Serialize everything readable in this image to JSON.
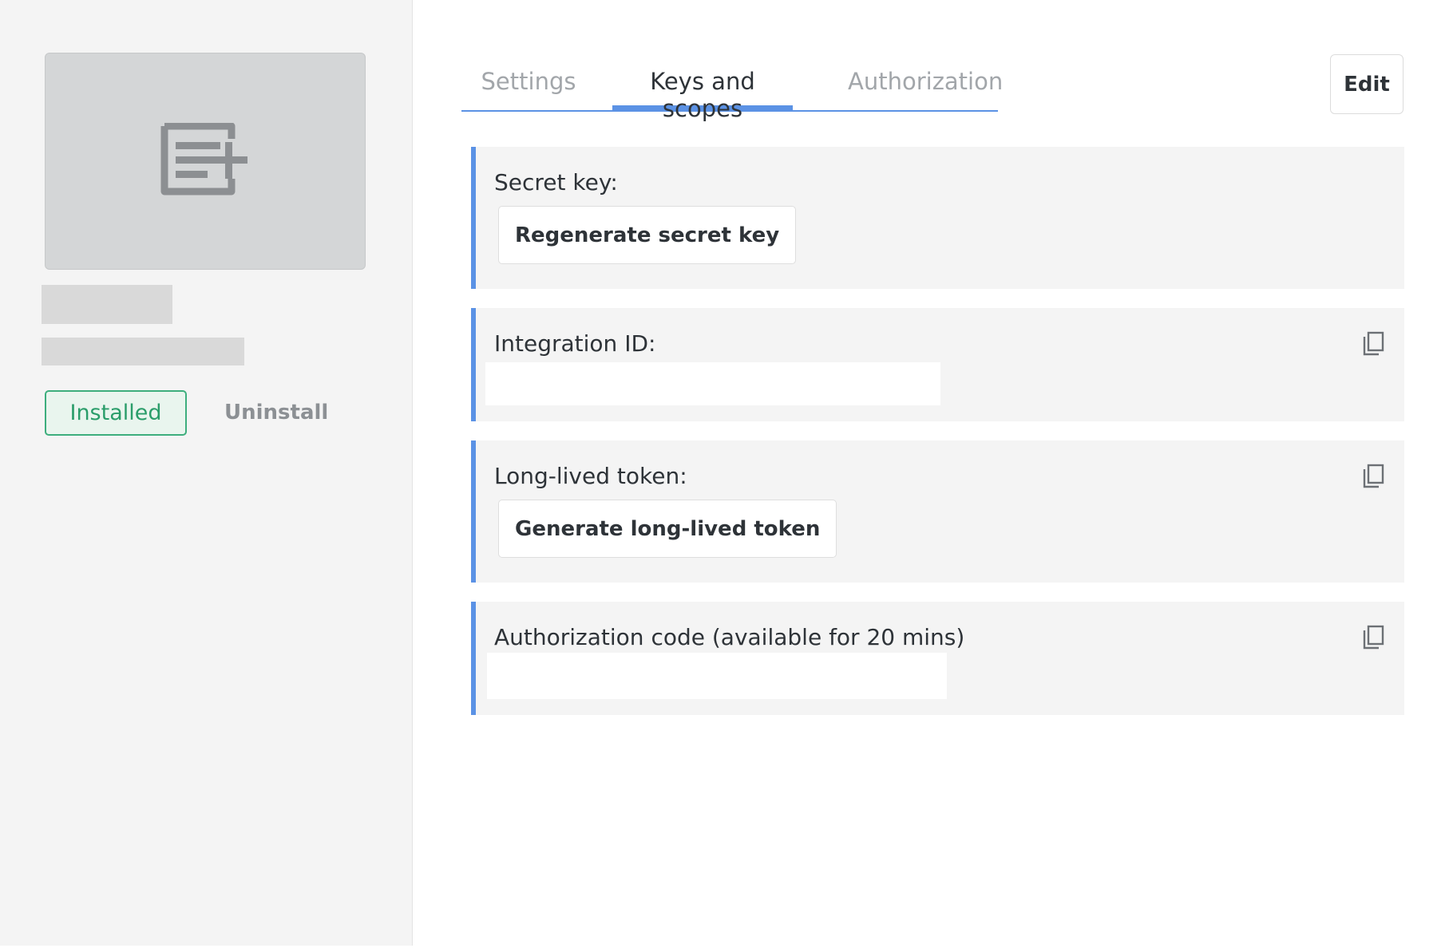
{
  "sidebar": {
    "installed_label": "Installed",
    "uninstall_label": "Uninstall"
  },
  "tabs": [
    {
      "label": "Settings",
      "active": false
    },
    {
      "label": "Keys and scopes",
      "active": true
    },
    {
      "label": "Authorization",
      "active": false
    }
  ],
  "header": {
    "edit_label": "Edit"
  },
  "cards": {
    "secret_key": {
      "label": "Secret key:",
      "button_label": "Regenerate secret key"
    },
    "integration_id": {
      "label": "Integration ID:"
    },
    "long_lived_token": {
      "label": "Long-lived token:",
      "button_label": "Generate long-lived token"
    },
    "authorization_code": {
      "label": "Authorization code (available for 20 mins)"
    }
  },
  "colors": {
    "accent": "#5b92e5",
    "installed": "#3dae7d",
    "card_bg": "#f4f4f4"
  }
}
